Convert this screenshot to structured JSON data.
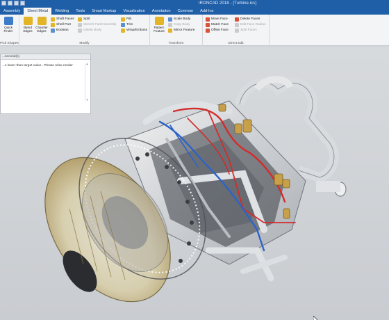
{
  "app": {
    "title": "IRONCAD 2018 - [Turbine.ics]"
  },
  "menu": {
    "tabs": [
      {
        "label": "Assembly"
      },
      {
        "label": "Sheet Metal"
      },
      {
        "label": "Welding"
      },
      {
        "label": "Tools"
      },
      {
        "label": "Smart Markup"
      },
      {
        "label": "Visualization"
      },
      {
        "label": "Annotation"
      },
      {
        "label": "Common"
      },
      {
        "label": "Add-Ins"
      }
    ]
  },
  "ribbon": {
    "pick_shapes": {
      "quick_label": "Quick\nFinder",
      "group_label": "Pick Shapes"
    },
    "modify": {
      "blend_label": "Blend\nEdges",
      "chamfer_label": "Chamfer\nEdges",
      "shaft_faces": "Shaft Faces",
      "shell_part": "Shell Part",
      "boolean": "Boolean",
      "split": "Split",
      "stretch": "Stretch Part/Assembly",
      "delete_body": "Delete Body",
      "rib": "Rib",
      "trim": "Trim",
      "wrap": "Wrap/Emboss",
      "group_label": "Modify"
    },
    "transform": {
      "pattern_label": "Pattern\nFeature",
      "scale_body": "Scale Body",
      "copy_body": "Copy Body",
      "mirror_feature": "Mirror Feature",
      "group_label": "Transform"
    },
    "direct_edit": {
      "move_face": "Move Face",
      "match_face": "Match Face",
      "offset_face": "Offset Face",
      "delete_faces": "Delete Faces",
      "edit_face_radius": "Edit Face Radius",
      "split_faces": "Split Faces",
      "group_label": "Direct Edit"
    }
  },
  "output_panel": {
    "header": "...second(s)",
    "message": "...s lower than target value.. Please relax render"
  },
  "colors": {
    "title_bar": "#1f5fa8",
    "ribbon_bg": "#f3f4f6",
    "viewport_bg": "#cfd3d7",
    "pipe_red": "#d42b2b",
    "pipe_blue": "#2d63c8",
    "brass": "#c8a04a"
  }
}
